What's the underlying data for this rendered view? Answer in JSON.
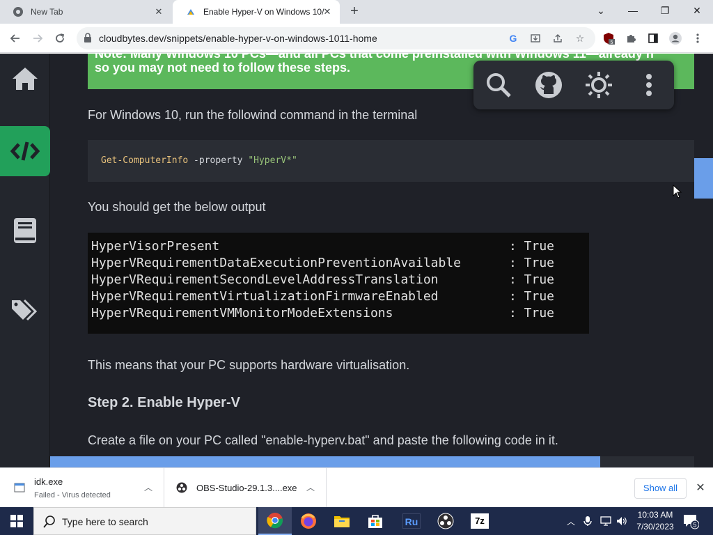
{
  "browser": {
    "tabs": [
      {
        "title": "New Tab"
      },
      {
        "title": "Enable Hyper-V on Windows 10/"
      }
    ],
    "url": "cloudbytes.dev/snippets/enable-hyper-v-on-windows-1011-home",
    "extension_badge": "5"
  },
  "page": {
    "note_line1": "Note: Many Windows 10 PCs—and all PCs that come preinstalled with Windows 11—already h",
    "note_line2": "so you may not need to follow these steps.",
    "para1": "For Windows 10, run the followind command in the terminal",
    "code": {
      "command": "Get-ComputerInfo",
      "flag": " -property ",
      "arg": "\"HyperV*\""
    },
    "para2": "You should get the below output",
    "output_rows": [
      {
        "key": "HyperVisorPresent",
        "value": ": True"
      },
      {
        "key": "HyperVRequirementDataExecutionPreventionAvailable",
        "value": ": True"
      },
      {
        "key": "HyperVRequirementSecondLevelAddressTranslation",
        "value": ": True"
      },
      {
        "key": "HyperVRequirementVirtualizationFirmwareEnabled",
        "value": ": True"
      },
      {
        "key": "HyperVRequirementVMMonitorModeExtensions",
        "value": ": True"
      }
    ],
    "para3": "This means that your PC supports hardware virtualisation.",
    "step_heading": "Step 2. Enable Hyper-V",
    "para4": "Create a file on your PC called \"enable-hyperv.bat\" and paste the following code in it."
  },
  "downloads": [
    {
      "name": "idk.exe",
      "status": "Failed - Virus detected"
    },
    {
      "name": "OBS-Studio-29.1.3....exe",
      "status": ""
    }
  ],
  "downloads_show_all": "Show all",
  "taskbar": {
    "search_placeholder": "Type here to search",
    "app_7z_label": "7z",
    "app_ru_label": "Ru",
    "time": "10:03 AM",
    "date": "7/30/2023",
    "notification_count": "5"
  },
  "colors": {
    "accent_green": "#22a05a",
    "note_green": "#5cb85c",
    "scroll_blue": "#6a9ee9"
  }
}
